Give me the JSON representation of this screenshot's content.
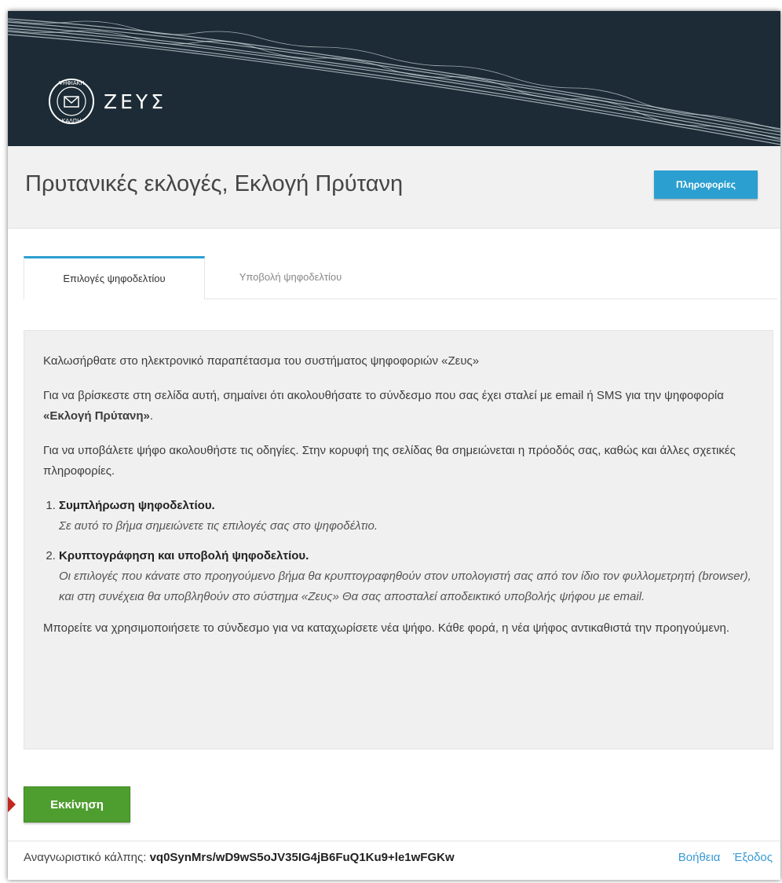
{
  "header": {
    "logo_text": "ΖΕΥΣ",
    "seal_text_top": "ΨΗΦΙΑΚΗ",
    "seal_text_bottom": "ΚΑΛΠΗ",
    "background": "#1c2b35"
  },
  "titlebar": {
    "title": "Πρυτανικές εκλογές, Εκλογή Πρύτανη",
    "info_button": "Πληροφορίες"
  },
  "tabs": [
    {
      "label": "Επιλογές ψηφοδελτίου",
      "active": true
    },
    {
      "label": "Υποβολή ψηφοδελτίου",
      "active": false
    }
  ],
  "content": {
    "welcome": "Καλωσήρθατε στο ηλεκτρονικό παραπέτασμα του συστήματος ψηφοφοριών «Ζευς»",
    "intro_before": "Για να βρίσκεστε στη σελίδα αυτή, σημαίνει ότι ακολουθήσατε το σύνδεσμο που σας έχει σταλεί με email ή SMS για την ψηφοφορία ",
    "intro_election": "«Εκλογή Πρύτανη»",
    "intro_after": ".",
    "instructions": "Για να υποβάλετε ψήφο ακολουθήστε τις οδηγίες. Στην κορυφή της σελίδας θα σημειώνεται η πρόοδός σας, καθώς και άλλες σχετικές πληροφορίες.",
    "steps": [
      {
        "title": "Συμπλήρωση ψηφοδελτίου.",
        "desc": "Σε αυτό το βήμα σημειώνετε τις επιλογές σας στο ψηφοδέλτιο."
      },
      {
        "title": "Κρυπτογράφηση και υποβολή ψηφοδελτίου.",
        "desc": "Οι επιλογές που κάνατε στο προηγούμενο βήμα θα κρυπτογραφηθούν στον υπολογιστή σας από τον ίδιο τον φυλλομετρητή (browser), και στη συνέχεια θα υποβληθούν στο σύστημα «Ζευς» Θα σας αποσταλεί αποδεικτικό υποβολής ψήφου με email."
      }
    ],
    "revote": "Μπορείτε να χρησιμοποιήσετε το σύνδεσμο για να καταχωρίσετε νέα ψήφο. Κάθε φορά, η νέα ψήφος αντικαθιστά την προηγούμενη."
  },
  "start_button": "Εκκίνηση",
  "footer": {
    "voter_label": "Αναγνωριστικό κάλπης:",
    "voter_id": "vq0SynMrs/wD9wS5oJV35IG4jB6FuQ1Ku9+le1wFGKw",
    "help": "Βοήθεια",
    "logout": "Έξοδος"
  },
  "colors": {
    "accent_blue": "#2b9fd0",
    "start_green": "#4e9e2f",
    "link_blue": "#3a9ad4",
    "arrow_red": "#c0281e"
  }
}
